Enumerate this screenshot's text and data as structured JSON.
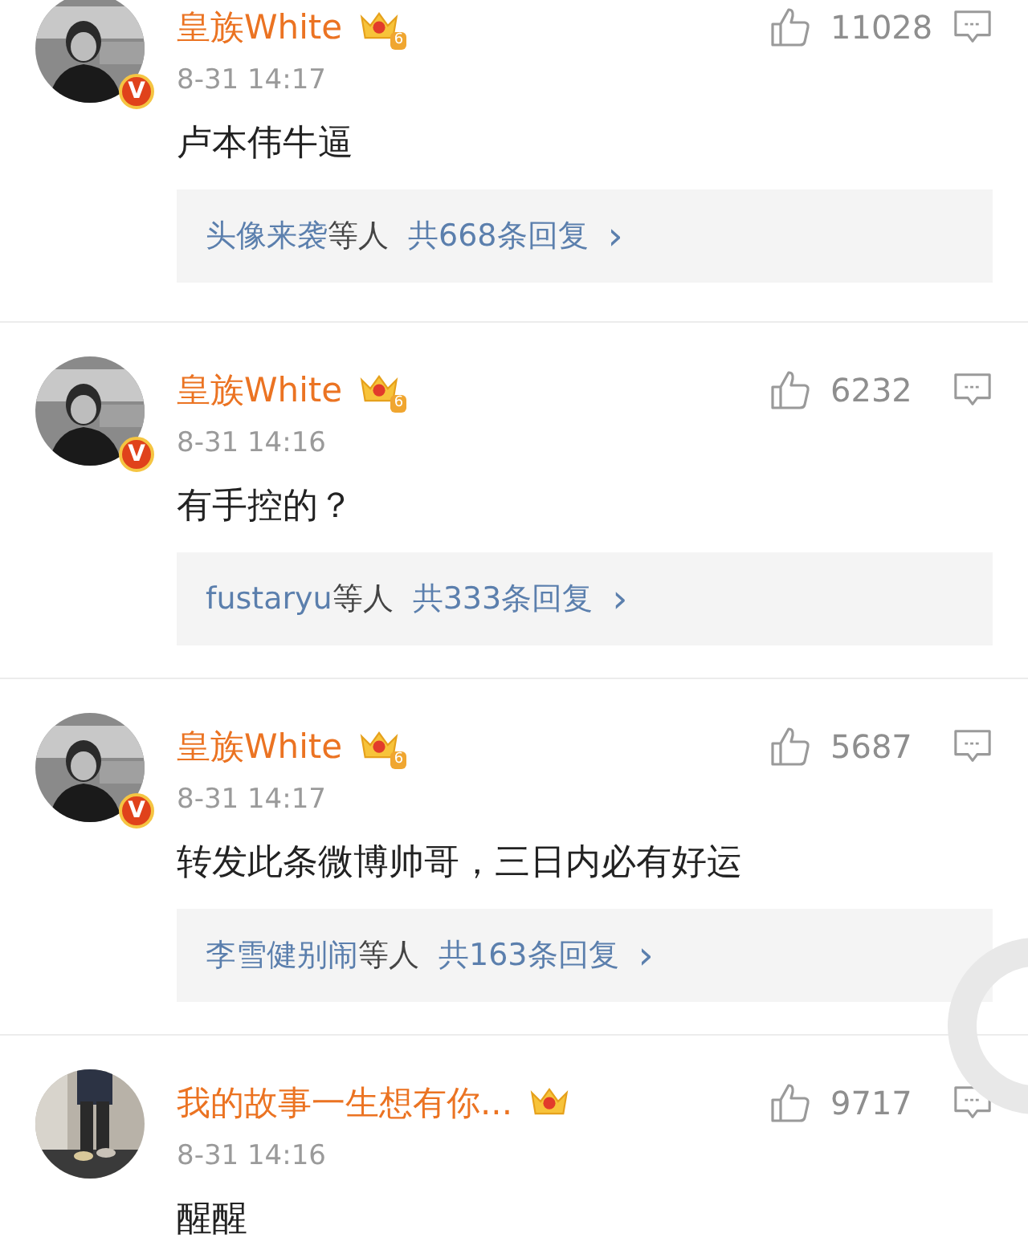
{
  "comments": [
    {
      "name": "皇族White",
      "crown_level": "6",
      "verified_mark": "V",
      "time": "8-31 14:17",
      "text": "卢本伟牛逼",
      "likes": "11028",
      "replies": {
        "users": "头像来袭",
        "suffix": "等人",
        "count": "共668条回复",
        "arrow": "›"
      }
    },
    {
      "name": "皇族White",
      "crown_level": "6",
      "verified_mark": "V",
      "time": "8-31 14:16",
      "text": "有手控的？",
      "likes": "6232",
      "replies": {
        "users": "fustaryu",
        "suffix": "等人",
        "count": "共333条回复",
        "arrow": "›"
      }
    },
    {
      "name": "皇族White",
      "crown_level": "6",
      "verified_mark": "V",
      "time": "8-31 14:17",
      "text": "转发此条微博帅哥，三日内必有好运",
      "likes": "5687",
      "replies": {
        "users": "李雪健别闹",
        "suffix": "等人",
        "count": "共163条回复",
        "arrow": "›"
      }
    },
    {
      "name": "我的故事一生想有你...",
      "time": "8-31 14:16",
      "text": "醒醒",
      "likes": "9717"
    }
  ]
}
